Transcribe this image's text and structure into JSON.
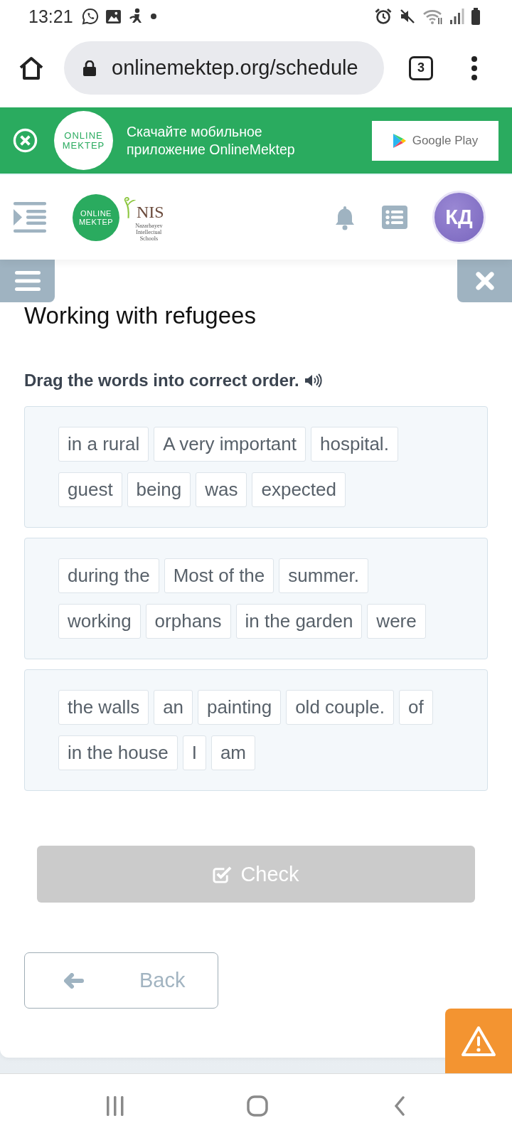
{
  "status_bar": {
    "time": "13:21"
  },
  "browser": {
    "url": "onlinemektep.org/schedule",
    "tab_count": "3"
  },
  "app_banner": {
    "logo_lines": [
      "ONLINE",
      "MEKTEP"
    ],
    "text_lines": [
      "Скачайте мобильное",
      "приложение OnlineMektep"
    ],
    "store_button": "Google Play"
  },
  "header": {
    "logo_lines": [
      "ONLINE",
      "MEKTEP"
    ],
    "partner_logo": {
      "title": "NIS",
      "subtitle_lines": [
        "Nazarbayev",
        "Intellectual",
        "Schools"
      ]
    },
    "avatar": "КД"
  },
  "lesson": {
    "title": "Working with refugees",
    "instruction": "Drag the words into correct order."
  },
  "sentences": [
    {
      "lines": [
        [
          "in a rural",
          "A very important",
          "hospital."
        ],
        [
          "guest",
          "being",
          "was",
          "expected"
        ]
      ]
    },
    {
      "lines": [
        [
          "during the",
          "Most of the",
          "summer."
        ],
        [
          "working",
          "orphans",
          "in the garden",
          "were"
        ]
      ]
    },
    {
      "lines": [
        [
          "the walls",
          "an",
          "painting",
          "old couple.",
          "of"
        ],
        [
          "in the house",
          "I",
          "am"
        ]
      ]
    }
  ],
  "check_button": {
    "label": "Check",
    "disabled": true
  },
  "back_button": {
    "label": "Back"
  }
}
